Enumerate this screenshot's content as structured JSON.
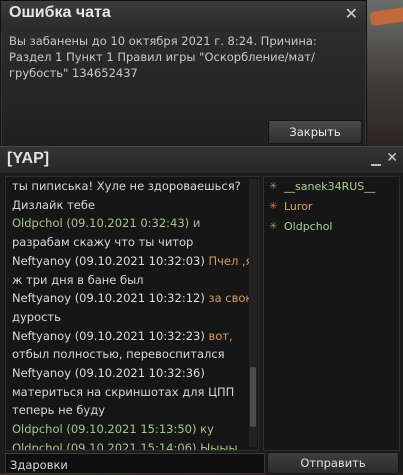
{
  "error_dialog": {
    "title": "Ошибка чата",
    "close_icon": "close-icon",
    "message": "Вы забанены до 10 октября 2021 г. 8:24. Причина: Раздел 1 Пункт 1 Правил игры \"Оскорбление/мат/грубость\" 134652437",
    "close_button_label": "Закрыть"
  },
  "chat": {
    "title": "[YAP]",
    "minimize_icon": "minimize-icon",
    "close_icon": "close-icon",
    "messages": [
      {
        "author": "",
        "text": "ты пиписька! Хуле не здороваешься?"
      },
      {
        "author": "",
        "text": "Дизлайк тебе"
      },
      {
        "author": "Oldpchol",
        "time": "(09.10.2021 0:32:43)",
        "text": "и"
      },
      {
        "author": "",
        "text": "разрабам скажу что ты читор"
      },
      {
        "author": "Neftyanoy",
        "time": "(09.10.2021 10:32:03)",
        "text": "Пчел ,я"
      },
      {
        "author": "",
        "text": "ж три дня в бане был"
      },
      {
        "author": "Neftyanoy",
        "time": "(09.10.2021 10:32:12)",
        "text": "за свою"
      },
      {
        "author": "",
        "text": "дурость"
      },
      {
        "author": "Neftyanoy",
        "time": "(09.10.2021 10:32:23)",
        "text": "вот,"
      },
      {
        "author": "",
        "text": "отбыл полностью, перевоспитался"
      },
      {
        "author": "Neftyanoy",
        "time": "(09.10.2021 10:32:36)",
        "text": ""
      },
      {
        "author": "",
        "text": "материться на скриншотах для ЦПП"
      },
      {
        "author": "",
        "text": "теперь не буду"
      },
      {
        "author": "Oldpchol",
        "time": "(09.10.2021 15:13:50)",
        "text": "ку"
      },
      {
        "author": "Oldpchol",
        "time": "(09.10.2021 15:14:06)",
        "text": "Ыыыы"
      }
    ],
    "members": [
      {
        "name": "__sanek34RUS__",
        "status": "green"
      },
      {
        "name": "Luror",
        "status": "orange"
      },
      {
        "name": "Oldpchol",
        "status": "green"
      }
    ],
    "input": {
      "value": "Здаровки",
      "placeholder": ""
    },
    "send_button_label": "Отправить"
  },
  "colors": {
    "online_green": "#6aa84f",
    "orange": "#d9773a",
    "author_green": "#9fc98a",
    "panel_bg": "#161616"
  }
}
